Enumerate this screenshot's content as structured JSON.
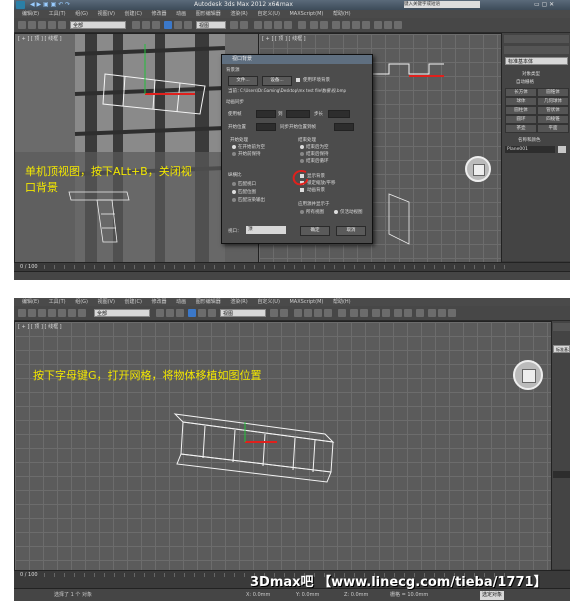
{
  "panel1": {
    "title": {
      "app": "Autodesk 3ds Max  2012 x64",
      "file": "r.max",
      "search_text": "键入关键字或短语"
    },
    "menu": [
      "编辑(E)",
      "工具(T)",
      "组(G)",
      "视图(V)",
      "创建(C)",
      "修改器",
      "动画",
      "图形编辑器",
      "渲染(R)",
      "自定义(U)",
      "MAXScript(M)",
      "帮助(H)"
    ],
    "toolbar": {
      "selection_filter": "全部",
      "ref_coord": "视图"
    },
    "viewport_top_label": "[ + ] [ 顶 ] [ 线框 ]",
    "viewport_left_label": "[ + ] [ 顶 ] [ 线框 ]",
    "annotation_lines": [
      "单机顶视图，按下ALt+B，关闭视",
      "口背景"
    ],
    "dialog": {
      "title": "视口背景",
      "section_background_source": "背景源",
      "files_button": "文件...",
      "devices_button": "设备...",
      "use_env_bg": "使用环境背景",
      "current_label": "当前：",
      "current_path": "C:\\Users\\Dr.Gaming\\Desktop\\mx test file\\数模\\视.bmp",
      "section_anim_sync": "动画同步",
      "use_frame": "使用帧",
      "to": "到",
      "step": "步长",
      "start_at": "开始位置",
      "sync_start": "同步开始位置到帧",
      "start_processing": "开始处理",
      "end_processing": "结束处理",
      "start_opts": [
        "在开始前为空",
        "开始前保持"
      ],
      "end_opts": [
        "结束后为空",
        "结束后保持",
        "结束后循环"
      ],
      "aspect_section": "纵横比",
      "aspect_opts": [
        "匹配视口",
        "匹配位图",
        "匹配渲染输出"
      ],
      "display_bg": "显示背景",
      "lock_zoom": "锁定缩放/平移",
      "anim_bg": "动画背景",
      "apply_to": "应用源并显示于",
      "apply_opts": [
        "所有视图",
        "仅活动视图"
      ],
      "viewport_label": "视口：",
      "viewport_value": "顶",
      "ok": "确定",
      "cancel": "取消"
    },
    "command_panel": {
      "dropdown": "标准基本体",
      "section_object_type": "对象类型",
      "auto_grid": "自动栅格",
      "buttons": [
        "长方体",
        "圆锥体",
        "球体",
        "几何球体",
        "圆柱体",
        "管状体",
        "圆环",
        "四棱锥",
        "茶壶",
        "平面"
      ],
      "section_name_color": "名称和颜色",
      "object_name": "Plane001"
    },
    "timeline_text": "0 / 100"
  },
  "panel2": {
    "menu": [
      "编辑(E)",
      "工具(T)",
      "组(G)",
      "视图(V)",
      "创建(C)",
      "修改器",
      "动画",
      "图形编辑器",
      "渲染(R)",
      "自定义(U)",
      "MAXScript(M)",
      "帮助(H)"
    ],
    "toolbar": {
      "selection_filter": "全部",
      "ref_coord": "视图"
    },
    "viewport_label": "[ + ] [ 顶 ] [ 线框 ]",
    "annotation": "按下字母键G，打开网格，将物体移植如图位置",
    "command_panel": {
      "dropdown": "标准基本"
    },
    "timeline_text": "0 / 100",
    "status_left": "选择了 1 个 对象",
    "status_grid": "栅格 = 10.0mm",
    "status_coords": [
      "X: 0.0mm",
      "Y: 0.0mm",
      "Z: 0.0mm"
    ],
    "status_right": "选定对象"
  },
  "watermark": "3Dmax吧 【www.linecg.com/tieba/1771】",
  "colors": {
    "annotation": "#f2e700",
    "red_mark": "#e0201c",
    "viewport_bg": "#5b5b5b"
  }
}
